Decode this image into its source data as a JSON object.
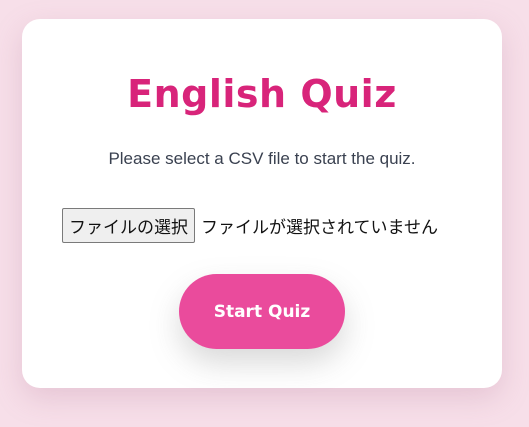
{
  "quiz": {
    "title": "English Quiz",
    "instruction": "Please select a CSV file to start the quiz.",
    "file_input": {
      "button_label": "ファイルの選択",
      "status_text": "ファイルが選択されていません"
    },
    "start_button_label": "Start Quiz"
  },
  "colors": {
    "page_background": "#f7dfe9",
    "title": "#d8247a",
    "accent_button": "#ea4b9c"
  }
}
